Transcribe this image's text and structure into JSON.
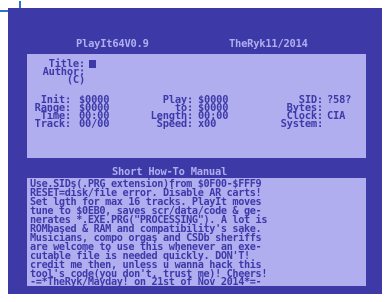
{
  "header": {
    "title": "PlayIt64V0.9",
    "credit": "TheRyk11/2014"
  },
  "fields": {
    "title_label": "Title:",
    "author_label": "Author:",
    "c_label": "(C)",
    "init_label": "Init:",
    "init_value": "$0000",
    "play_label": "Play:",
    "play_value": "$0000",
    "sid_label": "SID:",
    "sid_value": "?58?",
    "range_label": "Range:",
    "range_value": "$0000",
    "to_label": "to:",
    "to_value": "$0000",
    "bytes_label": "Bytes:",
    "time_label": "Time:",
    "time_value": "00:00",
    "length_label": "Length:",
    "length_value": "00:00",
    "clock_label": "Clock:",
    "clock_value": "CIA",
    "track_label": "Track:",
    "track_value": "00/00",
    "speed_label": "Speed:",
    "speed_value": "x00",
    "system_label": "System:"
  },
  "manual": {
    "title": "Short How-To Manual",
    "lines": [
      "Use.SIDs(.PRG extension)from $0F00-$FFF9",
      "RESET=disk/file error. Disable AR carts!",
      "Set lgth for max 16 tracks. PlayIt moves",
      "tune to $0EB0, saves scr/data/code & ge-",
      "nerates *.EXE.PRG(\"PROCESSING\"). A lot is",
      "ROMbased & RAM and compatibility's sake.",
      "Musicians, compo orgas and CSDb sheriffs",
      "are welcome to use this whenever an exe-",
      "cutable file is needed quickly. DON'T!",
      "credit me then, unless u wanna hack this",
      "tool's code(you don't, trust me)! Cheers!",
      "-=*TheRyk/Mayday! on 21st of Nov 2014*=-"
    ]
  },
  "colors": {
    "background": "#3d3aa8",
    "text": "#b1aef0",
    "corner_mark": "#2f6fd6"
  }
}
